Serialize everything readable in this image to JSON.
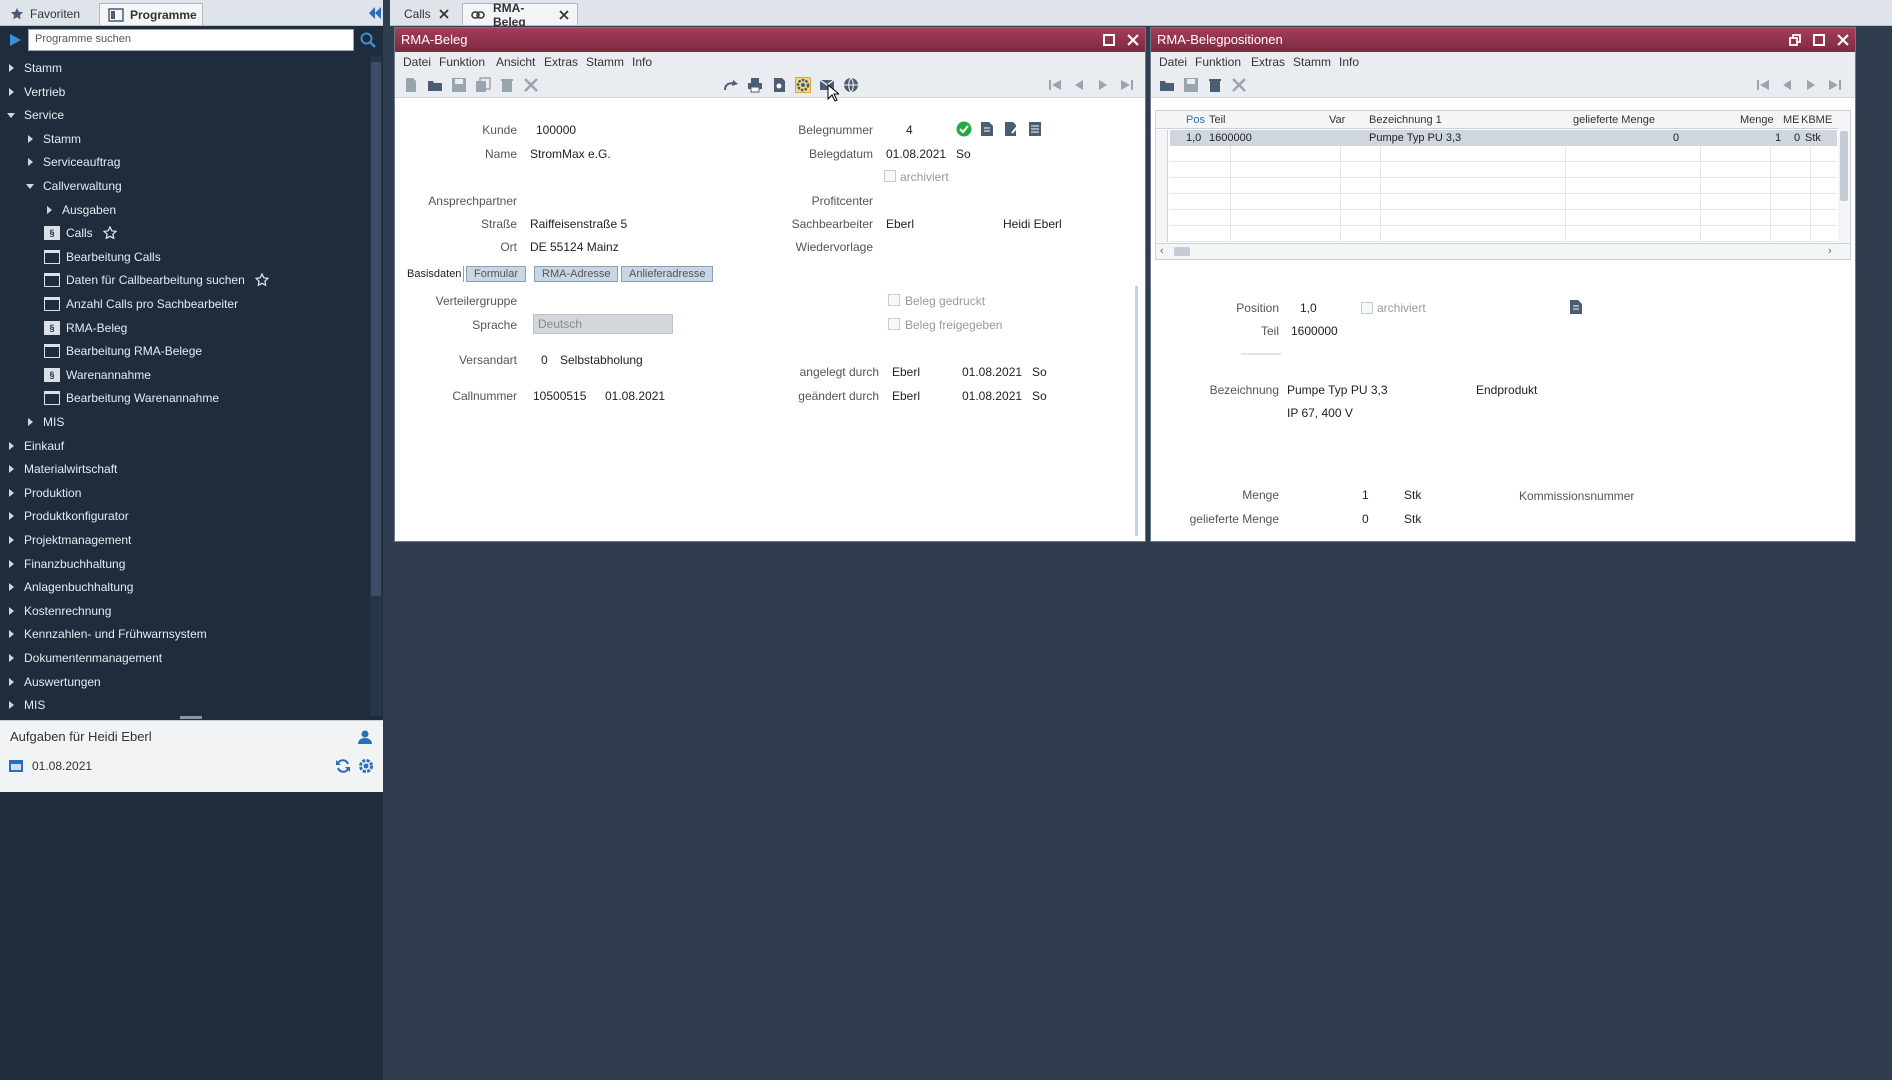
{
  "left_panel": {
    "tabs": {
      "favorites": "Favoriten",
      "programs": "Programme"
    },
    "search": {
      "placeholder": "Programme suchen",
      "value": "Programme suchen"
    },
    "tree": [
      {
        "label": "Stamm",
        "level": 0,
        "state": "collapsed",
        "icon": "none"
      },
      {
        "label": "Vertrieb",
        "level": 0,
        "state": "collapsed",
        "icon": "none"
      },
      {
        "label": "Service",
        "level": 0,
        "state": "expanded",
        "icon": "none"
      },
      {
        "label": "Stamm",
        "level": 1,
        "state": "collapsed",
        "icon": "none"
      },
      {
        "label": "Serviceauftrag",
        "level": 1,
        "state": "collapsed",
        "icon": "none"
      },
      {
        "label": "Callverwaltung",
        "level": 1,
        "state": "expanded",
        "icon": "none"
      },
      {
        "label": "Ausgaben",
        "level": 2,
        "state": "collapsed",
        "icon": "none"
      },
      {
        "label": "Calls",
        "level": 2,
        "state": "leaf",
        "icon": "sdoc",
        "star": true
      },
      {
        "label": "Bearbeitung Calls",
        "level": 2,
        "state": "leaf",
        "icon": "window"
      },
      {
        "label": "Daten für Callbearbeitung suchen",
        "level": 2,
        "state": "leaf",
        "icon": "window",
        "star": true
      },
      {
        "label": "Anzahl Calls pro Sachbearbeiter",
        "level": 2,
        "state": "leaf",
        "icon": "window"
      },
      {
        "label": "RMA-Beleg",
        "level": 2,
        "state": "leaf",
        "icon": "sdoc"
      },
      {
        "label": "Bearbeitung RMA-Belege",
        "level": 2,
        "state": "leaf",
        "icon": "window"
      },
      {
        "label": "Warenannahme",
        "level": 2,
        "state": "leaf",
        "icon": "sdoc"
      },
      {
        "label": "Bearbeitung Warenannahme",
        "level": 2,
        "state": "leaf",
        "icon": "window"
      },
      {
        "label": "MIS",
        "level": 1,
        "state": "collapsed",
        "icon": "none"
      },
      {
        "label": "Einkauf",
        "level": 0,
        "state": "collapsed",
        "icon": "none"
      },
      {
        "label": "Materialwirtschaft",
        "level": 0,
        "state": "collapsed",
        "icon": "none"
      },
      {
        "label": "Produktion",
        "level": 0,
        "state": "collapsed",
        "icon": "none"
      },
      {
        "label": "Produktkonfigurator",
        "level": 0,
        "state": "collapsed",
        "icon": "none"
      },
      {
        "label": "Projektmanagement",
        "level": 0,
        "state": "collapsed",
        "icon": "none"
      },
      {
        "label": "Finanzbuchhaltung",
        "level": 0,
        "state": "collapsed",
        "icon": "none"
      },
      {
        "label": "Anlagenbuchhaltung",
        "level": 0,
        "state": "collapsed",
        "icon": "none"
      },
      {
        "label": "Kostenrechnung",
        "level": 0,
        "state": "collapsed",
        "icon": "none"
      },
      {
        "label": "Kennzahlen- und Frühwarnsystem",
        "level": 0,
        "state": "collapsed",
        "icon": "none"
      },
      {
        "label": "Dokumentenmanagement",
        "level": 0,
        "state": "collapsed",
        "icon": "none"
      },
      {
        "label": "Auswertungen",
        "level": 0,
        "state": "collapsed",
        "icon": "none"
      },
      {
        "label": "MIS",
        "level": 0,
        "state": "collapsed",
        "icon": "none"
      }
    ],
    "tasks": {
      "title": "Aufgaben für Heidi Eberl",
      "date": "01.08.2021"
    }
  },
  "top_tabs": {
    "calls": "Calls",
    "rma": "RMA-Beleg"
  },
  "rma_window": {
    "title": "RMA-Beleg",
    "menu": [
      "Datei",
      "Funktion",
      "Ansicht",
      "Extras",
      "Stamm",
      "Info"
    ],
    "fields": {
      "kunde_label": "Kunde",
      "kunde": "100000",
      "name_label": "Name",
      "name": "StromMax e.G.",
      "ansprechpartner_label": "Ansprechpartner",
      "strasse_label": "Straße",
      "strasse": "Raiffeisenstraße 5",
      "ort_label": "Ort",
      "ort": "DE 55124 Mainz",
      "belegnummer_label": "Belegnummer",
      "belegnummer": "4",
      "belegdatum_label": "Belegdatum",
      "belegdatum": "01.08.2021",
      "belegdatum_day": "So",
      "archiviert_label": "archiviert",
      "profitcenter_label": "Profitcenter",
      "sachbearbeiter_label": "Sachbearbeiter",
      "sachbearbeiter": "Eberl",
      "sachbearbeiter_name": "Heidi Eberl",
      "wiedervorlage_label": "Wiedervorlage"
    },
    "tabs": [
      "Basisdaten",
      "Formular",
      "RMA-Adresse",
      "Anlieferadresse"
    ],
    "basis": {
      "verteilergruppe_label": "Verteilergruppe",
      "sprache_label": "Sprache",
      "sprache": "Deutsch",
      "versandart_label": "Versandart",
      "versandart_code": "0",
      "versandart": "Selbstabholung",
      "callnummer_label": "Callnummer",
      "callnummer": "10500515",
      "calldatum": "01.08.2021",
      "beleg_gedruckt": "Beleg gedruckt",
      "beleg_freigegeben": "Beleg freigegeben",
      "angelegt_label": "angelegt durch",
      "angelegt_user": "Eberl",
      "angelegt_date": "01.08.2021",
      "angelegt_day": "So",
      "geaendert_label": "geändert durch",
      "geaendert_user": "Eberl",
      "geaendert_date": "01.08.2021",
      "geaendert_day": "So"
    }
  },
  "pos_window": {
    "title": "RMA-Belegpositionen",
    "menu": [
      "Datei",
      "Funktion",
      "Extras",
      "Stamm",
      "Info"
    ],
    "grid": {
      "headers": [
        "Pos",
        "Teil",
        "Var",
        "Bezeichnung 1",
        "gelieferte Menge",
        "Menge",
        "ME",
        "KBME"
      ],
      "row": {
        "pos": "1,0",
        "teil": "1600000",
        "var": "",
        "bez": "Pumpe Typ PU 3,3",
        "gel_menge": "0",
        "menge": "1",
        "me": "0",
        "kbme": "Stk"
      }
    },
    "detail": {
      "position_label": "Position",
      "position": "1,0",
      "archiviert_label": "archiviert",
      "teil_label": "Teil",
      "teil": "1600000",
      "bezeichnung_label": "Bezeichnung",
      "bezeichnung": "Pumpe Typ PU 3,3",
      "bezeichnung2": "IP 67, 400 V",
      "endprodukt": "Endprodukt",
      "menge_label": "Menge",
      "menge": "1",
      "menge_unit": "Stk",
      "gel_menge_label": "gelieferte Menge",
      "gel_menge": "0",
      "gel_menge_unit": "Stk",
      "kommission_label": "Kommissionsnummer"
    }
  },
  "colors": {
    "title_bar": "#8f3249",
    "panel_bg": "#1f2c3b",
    "desktop_bg": "#2f3d4e",
    "accent_green": "#27a844",
    "icon_blue": "#2a6fb5"
  }
}
